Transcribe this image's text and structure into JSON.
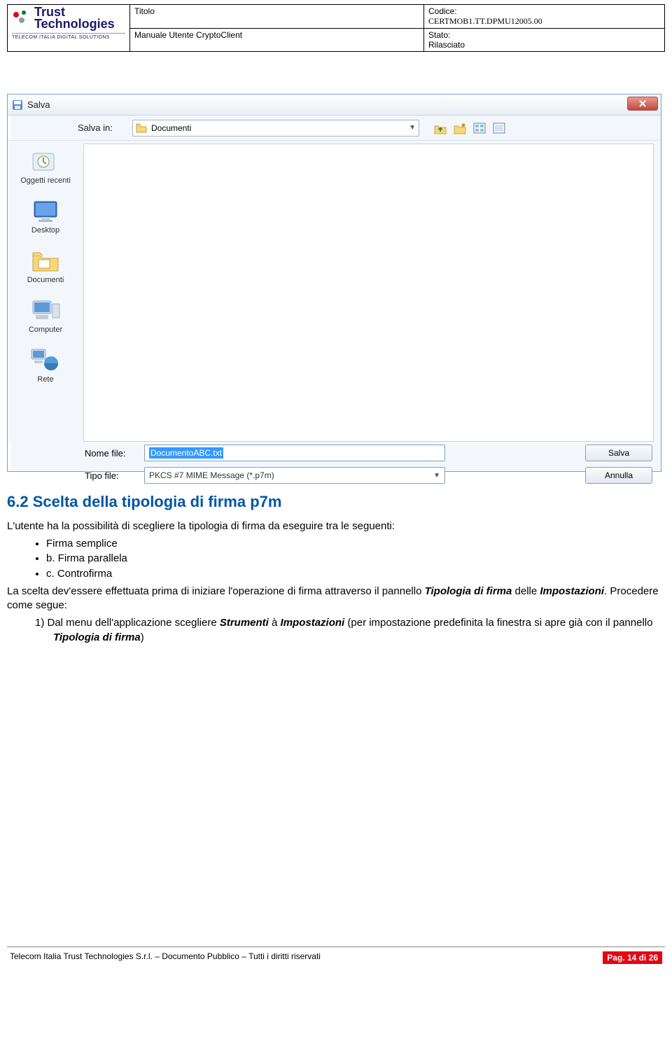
{
  "header": {
    "titolo_label": "Titolo",
    "manual_title": "Manuale Utente CryptoClient",
    "codice_label": "Codice:",
    "codice_value": "CERTMOB1.TT.DPMU12005.00",
    "stato_label": "Stato:",
    "stato_value": "Rilasciato",
    "logo_line1": "Trust",
    "logo_line2": "Technologies",
    "logo_sub": "TELECOM ITALIA DIGITAL SOLUTIONS"
  },
  "dialog": {
    "title": "Salva",
    "save_in_label": "Salva in:",
    "save_in_value": "Documenti",
    "places": [
      "Oggetti recenti",
      "Desktop",
      "Documenti",
      "Computer",
      "Rete"
    ],
    "filename_label": "Nome file:",
    "filename_value": "DocumentoABC.txt",
    "filetype_label": "Tipo file:",
    "filetype_value": "PKCS #7 MIME Message (*.p7m)",
    "save_button": "Salva",
    "cancel_button": "Annulla"
  },
  "section": {
    "heading": "6.2  Scelta della tipologia di firma  p7m",
    "intro": "L'utente ha la possibilità di scegliere la tipologia di firma da eseguire tra le seguenti:",
    "bullets": [
      "Firma semplice",
      "b. Firma parallela",
      "c. Controfirma"
    ],
    "para2_pre": "La scelta dev'essere effettuata prima di iniziare l'operazione di firma attraverso il pannello ",
    "para2_em1": "Tipologia di firma",
    "para2_mid": " delle ",
    "para2_em2": "Impostazioni",
    "para2_post": ". Procedere come segue:",
    "step1_pre": "1)   Dal menu dell'applicazione scegliere ",
    "step1_em1": "Strumenti",
    "step1_mid": " à ",
    "step1_em2": "Impostazioni",
    "step1_post1": " (per impostazione predefinita la finestra si apre già con il pannello ",
    "step1_em3": "Tipologia di firma",
    "step1_post2": ")"
  },
  "footer": {
    "left": "Telecom Italia Trust Technologies S.r.l. – Documento Pubblico – Tutti i diritti riservati",
    "right": "Pag. 14 di 26"
  }
}
